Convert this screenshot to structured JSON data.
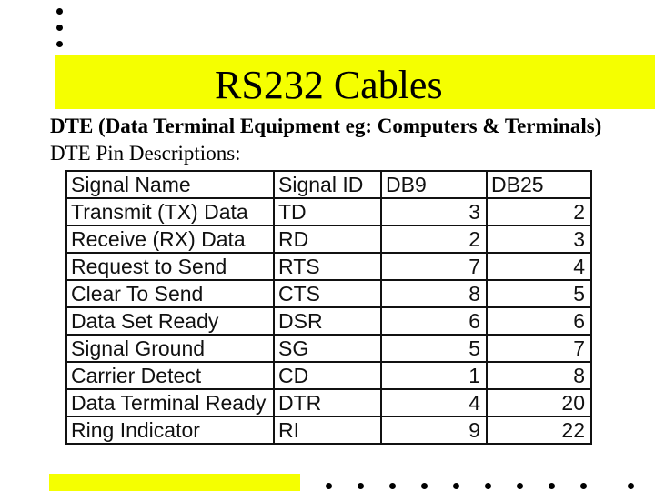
{
  "slide": {
    "title": "RS232 Cables",
    "accent_color": "#f5ff00",
    "subtitle": "DTE (Data Terminal Equipment eg: Computers & Terminals)",
    "subheading": "DTE Pin Descriptions:"
  },
  "table": {
    "headers": [
      "Signal Name",
      "Signal ID",
      "DB9",
      "DB25"
    ],
    "rows": [
      [
        "Transmit (TX) Data",
        "TD",
        "3",
        "2"
      ],
      [
        "Receive (RX) Data",
        "RD",
        "2",
        "3"
      ],
      [
        "Request to Send",
        "RTS",
        "7",
        "4"
      ],
      [
        "Clear To Send",
        "CTS",
        "8",
        "5"
      ],
      [
        "Data Set Ready",
        "DSR",
        "6",
        "6"
      ],
      [
        "Signal Ground",
        "SG",
        "5",
        "7"
      ],
      [
        "Carrier Detect",
        "CD",
        "1",
        "8"
      ],
      [
        "Data Terminal Ready",
        "DTR",
        "4",
        "20"
      ],
      [
        "Ring Indicator",
        "RI",
        "9",
        "22"
      ]
    ]
  }
}
